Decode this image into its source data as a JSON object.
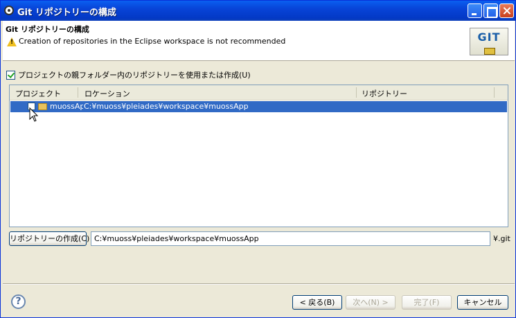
{
  "window": {
    "title": "Git リポジトリーの構成"
  },
  "header": {
    "title": "Git リポジトリーの構成",
    "message": "Creation of repositories in the Eclipse workspace is not recommended",
    "logo_text": "GIT"
  },
  "use_parent_checkbox": {
    "label": "プロジェクトの親フォルダー内のリポジトリーを使用または作成(U)",
    "checked": true
  },
  "table": {
    "columns": [
      "プロジェクト",
      "ロケーション",
      "リポジトリー"
    ],
    "rows": [
      {
        "project": "muossApp",
        "location": "C:¥muoss¥pleiades¥workspace¥muossApp",
        "repository": "",
        "checked": false,
        "selected": true
      }
    ]
  },
  "create_repo": {
    "button_label": "リポジトリーの作成(C)",
    "path_value": "C:¥muoss¥pleiades¥workspace¥muossApp",
    "suffix": "¥.git"
  },
  "footer": {
    "help_glyph": "?",
    "back_label": "< 戻る(B)",
    "next_label": "次へ(N) >",
    "finish_label": "完了(F)",
    "cancel_label": "キャンセル"
  },
  "colors": {
    "titlebar": "#0844d8",
    "selection": "#316ac5",
    "dialog_bg": "#ece9d8"
  }
}
